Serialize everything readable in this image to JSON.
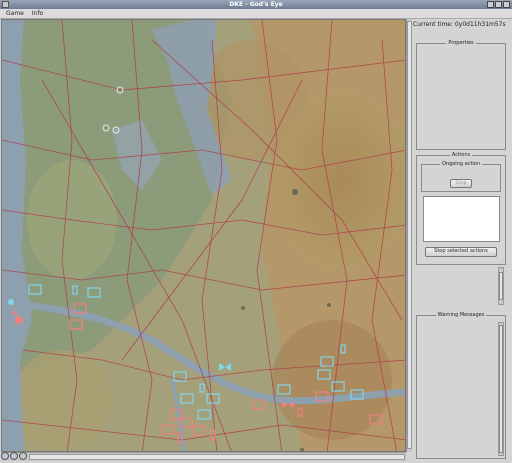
{
  "window": {
    "title": "DKE - God's Eye"
  },
  "menu": {
    "items": [
      {
        "label": "Game"
      },
      {
        "label": "Info"
      }
    ]
  },
  "status": {
    "current_time_label": "Current time:",
    "current_time_value": "0y0d11h31m57s"
  },
  "properties": {
    "title": "Properties"
  },
  "actions": {
    "title": "Actions",
    "ongoing_title": "Ongoing action",
    "stop_button": "Stop",
    "stop_selected_button": "Stop selected actions"
  },
  "warnings": {
    "title": "Warning Messages"
  },
  "colors": {
    "friendly": "#7fd6ea",
    "enemy": "#f08080",
    "road": "#b03a48",
    "water": "#8e9fae"
  },
  "map": {
    "friendly_units": 16,
    "enemy_units": 24,
    "icon_semantics": [
      "unit-box-icon",
      "robot-unit-icon",
      "bowtie-unit-icon"
    ]
  }
}
